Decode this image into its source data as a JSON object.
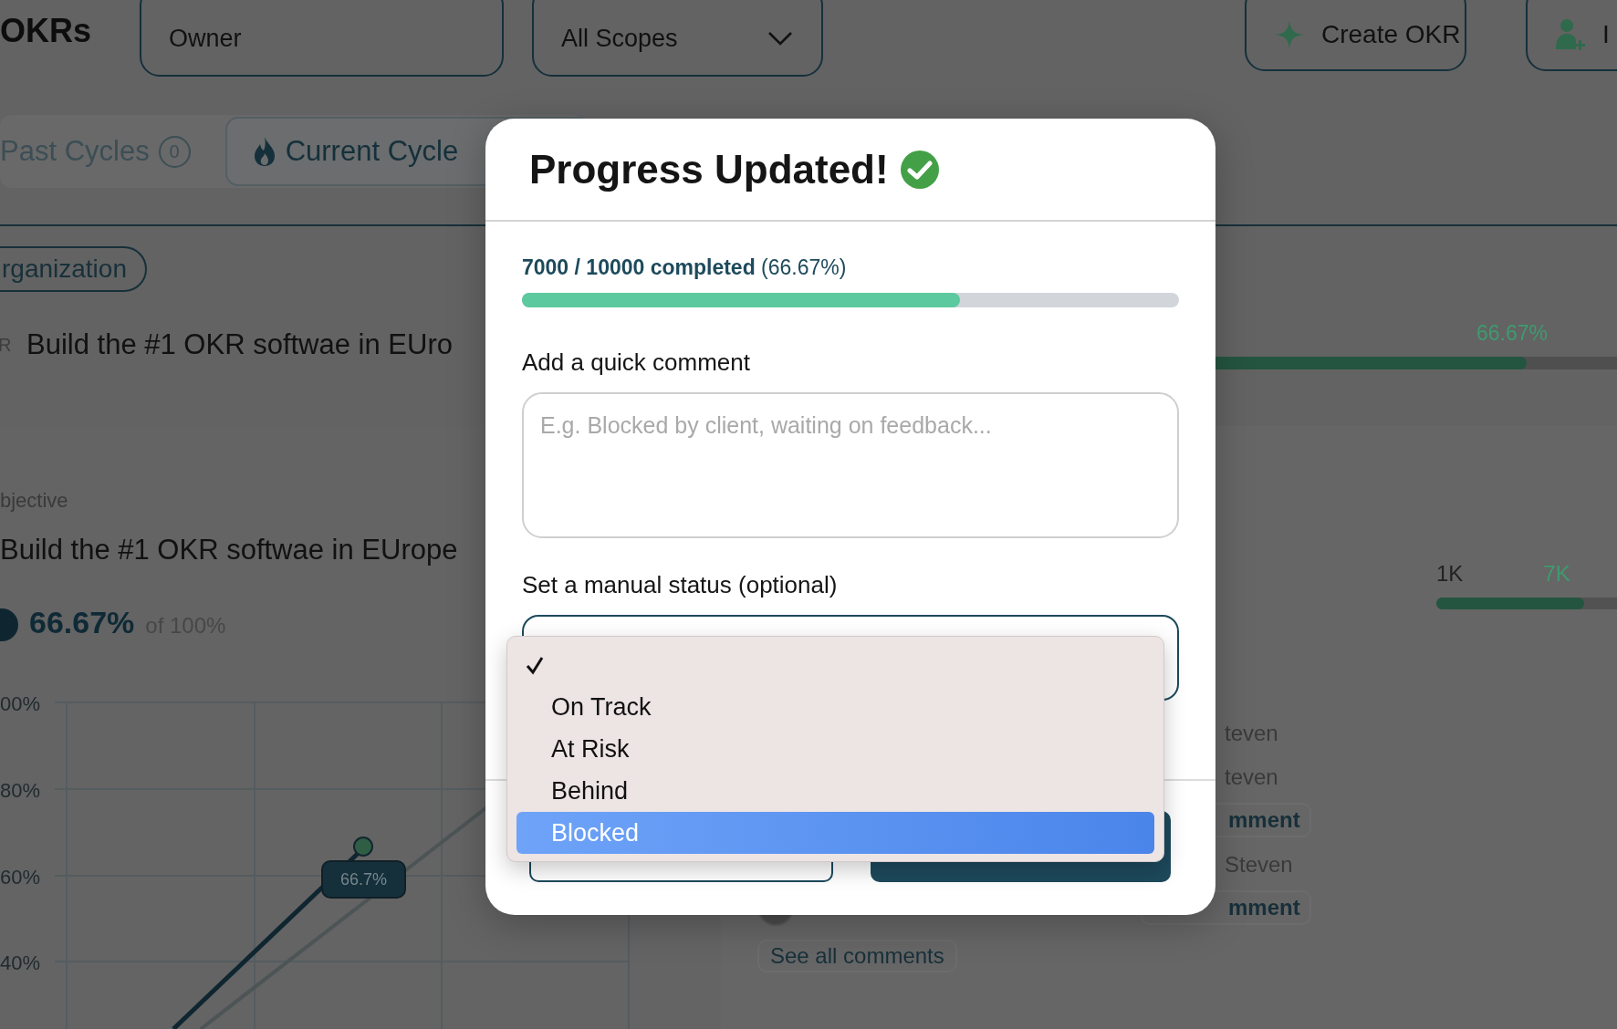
{
  "header": {
    "title": "OKRs",
    "owner_field": {
      "value": "Owner"
    },
    "scope_select": {
      "value": "All Scopes"
    },
    "buttons": [
      {
        "kind": "create",
        "label": "Create OKR"
      },
      {
        "kind": "invite",
        "label": "I"
      }
    ]
  },
  "cycle_tabs": [
    {
      "label": "Past Cycles",
      "count": "0",
      "selected": false
    },
    {
      "label": "Current Cycle",
      "selected": true
    }
  ],
  "scope_chip": "rganization",
  "key_result": {
    "prefix": "R",
    "title": "Build the #1 OKR softwae in EUro",
    "percent": "66.67%",
    "level": 0.6667
  },
  "objective": {
    "label": "bjective",
    "title": "Build the #1 OKR softwae in EUrope",
    "percent": "66.67%",
    "target": "of 100%"
  },
  "chart": {
    "y_labels": [
      "00%",
      "80%",
      "60%",
      "40%"
    ],
    "tooltip": "66.7%"
  },
  "metric": {
    "start": "1K",
    "current": "7K",
    "level": 0.6667
  },
  "comments": [
    {
      "kind": "author",
      "text": "teven"
    },
    {
      "kind": "author",
      "text": "teven"
    },
    {
      "kind": "action",
      "text": "mment"
    },
    {
      "kind": "author",
      "text": "Steven"
    },
    {
      "kind": "action",
      "text": "mment",
      "avatar": true
    }
  ],
  "see_all": "See all comments",
  "modal": {
    "title": "Progress Updated!",
    "progress": {
      "text": "**7000 / 10000 completed** (66.67%)",
      "level": 0.6667
    },
    "comment": {
      "label": "Add a quick comment",
      "placeholder": "E.g. Blocked by client, waiting on feedback..."
    },
    "status": {
      "label": "Set a manual status (optional)",
      "options": [
        {
          "kind": "none",
          "checked": true,
          "highlighted": false
        },
        {
          "kind": "option",
          "label": "On Track",
          "checked": false,
          "highlighted": false
        },
        {
          "kind": "option",
          "label": "At Risk",
          "checked": false,
          "highlighted": false
        },
        {
          "kind": "option",
          "label": "Behind",
          "checked": false,
          "highlighted": false
        },
        {
          "kind": "option",
          "label": "Blocked",
          "checked": false,
          "highlighted": true
        }
      ]
    },
    "footer_buttons": [
      {
        "kind": "secondary"
      },
      {
        "kind": "primary"
      }
    ]
  }
}
